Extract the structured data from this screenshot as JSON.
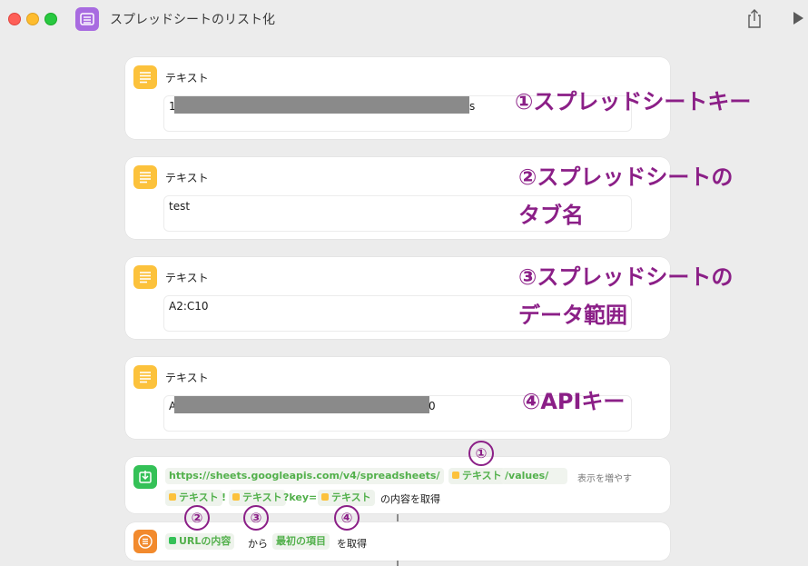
{
  "window": {
    "title": "スプレッドシートのリスト化"
  },
  "icons": {
    "app": "list-doc-icon",
    "share": "share-icon",
    "run": "play-icon",
    "text_action": "text-lines-icon",
    "get_contents": "download-icon",
    "get_item": "list-icon"
  },
  "colors": {
    "accent_annotation": "#8b1f87",
    "variable_green": "#52b04b",
    "text_icon": "#fcc23c"
  },
  "text_actions": [
    {
      "label": "テキスト",
      "value_prefix": "1",
      "value_suffix": "s",
      "annotation": [
        "①スプレッドシートキー"
      ]
    },
    {
      "label": "テキスト",
      "value_prefix": "test",
      "value_suffix": "",
      "annotation": [
        "②スプレッドシートの",
        "タブ名"
      ]
    },
    {
      "label": "テキスト",
      "value_prefix": "A2:C10",
      "value_suffix": "",
      "annotation": [
        "③スプレッドシートの",
        "データ範囲"
      ]
    },
    {
      "label": "テキスト",
      "value_prefix": "A",
      "value_suffix": "0",
      "annotation": [
        "④APIキー"
      ]
    }
  ],
  "get_contents": {
    "url_text": "https://sheets.googleapis.com/v4/spreadsheets/",
    "var1": "テキスト",
    "values_path": "/values/",
    "show_more": "表示を増やす",
    "var2": "テキスト",
    "bang": "!",
    "var3": "テキスト",
    "key_param": "?key=",
    "var4": "テキスト",
    "suffix": "の内容を取得"
  },
  "get_item": {
    "input_var": "URLの内容",
    "from": "から",
    "item": "最初の項目",
    "suffix": "を取得"
  },
  "numbers": [
    "①",
    "②",
    "③",
    "④"
  ]
}
